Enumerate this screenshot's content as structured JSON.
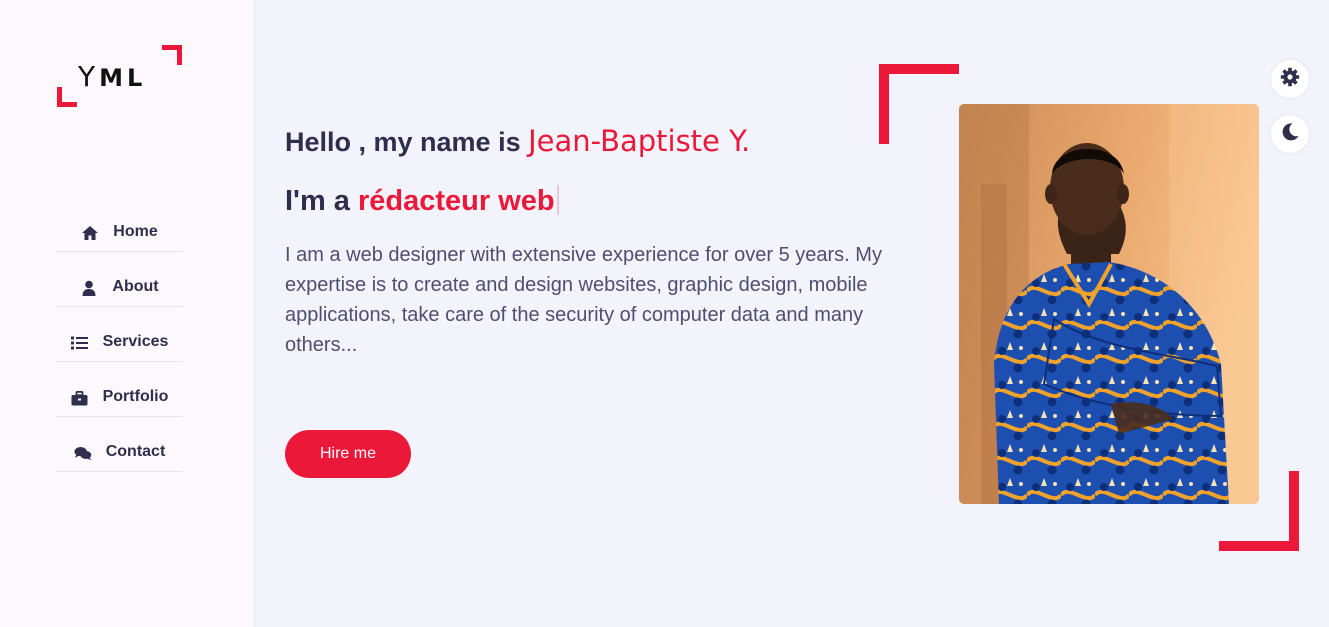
{
  "logo": {
    "letters": "Y",
    "rest": "ML"
  },
  "nav": [
    {
      "label": "Home",
      "icon": "home-icon"
    },
    {
      "label": "About",
      "icon": "user-icon"
    },
    {
      "label": "Services",
      "icon": "list-icon"
    },
    {
      "label": "Portfolio",
      "icon": "briefcase-icon"
    },
    {
      "label": "Contact",
      "icon": "comments-icon"
    }
  ],
  "hero": {
    "greeting_prefix": "Hello , my name is ",
    "name": "Jean-Baptiste Y.",
    "role_prefix": "I'm a ",
    "role_typed": "rédacteur web",
    "description": "I am a web designer with extensive experience for over 5 years. My expertise is to create and design websites, graphic design, mobile applications, take care of the security of computer data and many others...",
    "cta_label": "Hire me"
  },
  "controls": {
    "settings_icon": "gear-icon",
    "theme_icon": "moon-icon"
  },
  "colors": {
    "accent": "#ec1839",
    "text_dark": "#302e4d",
    "text_body": "#504e70",
    "bg_main": "#f2f3fb",
    "bg_sidebar": "#fcf8fc"
  }
}
